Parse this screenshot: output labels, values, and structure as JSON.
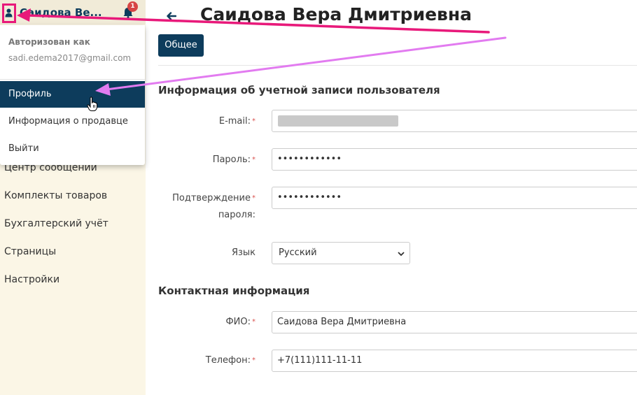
{
  "user_menu": {
    "name": "Саидова Ве...",
    "notifications_count": "1"
  },
  "dropdown": {
    "authorized_label": "Авторизован как",
    "email": "sadi.edema2017@gmail.com",
    "items": [
      {
        "label": "Профиль",
        "active": true
      },
      {
        "label": "Информация о продавце",
        "active": false
      },
      {
        "label": "Выйти",
        "active": false
      }
    ]
  },
  "sidebar": {
    "items": [
      {
        "label": "Центр сообщений"
      },
      {
        "label": "Комплекты товаров"
      },
      {
        "label": "Бухгалтерский учёт"
      },
      {
        "label": "Страницы"
      },
      {
        "label": "Настройки"
      }
    ]
  },
  "page": {
    "back_icon": "arrow-left-icon",
    "title": "Саидова Вера Дмитриевна"
  },
  "tabs": {
    "general": "Общее"
  },
  "account_section": {
    "title": "Информация об учетной записи пользователя",
    "email_label": "E-mail:",
    "password_label": "Пароль:",
    "password_value": "••••••••••••",
    "confirm_label_1": "Подтверждение",
    "confirm_label_2": "пароля:",
    "confirm_value": "••••••••••••",
    "language_label": "Язык",
    "language_value": "Русский"
  },
  "contact_section": {
    "title": "Контактная информация",
    "name_label": "ФИО:",
    "name_value": "Саидова Вера Дмитриевна",
    "phone_label": "Телефон:",
    "phone_value": "+7(111)111-11-11"
  },
  "colors": {
    "accent": "#0d3c5c",
    "sidebar_bg": "#fbf6e6",
    "annotation_pink": "#e8197a",
    "annotation_violet": "#e27bf0",
    "required": "#d9534f"
  }
}
